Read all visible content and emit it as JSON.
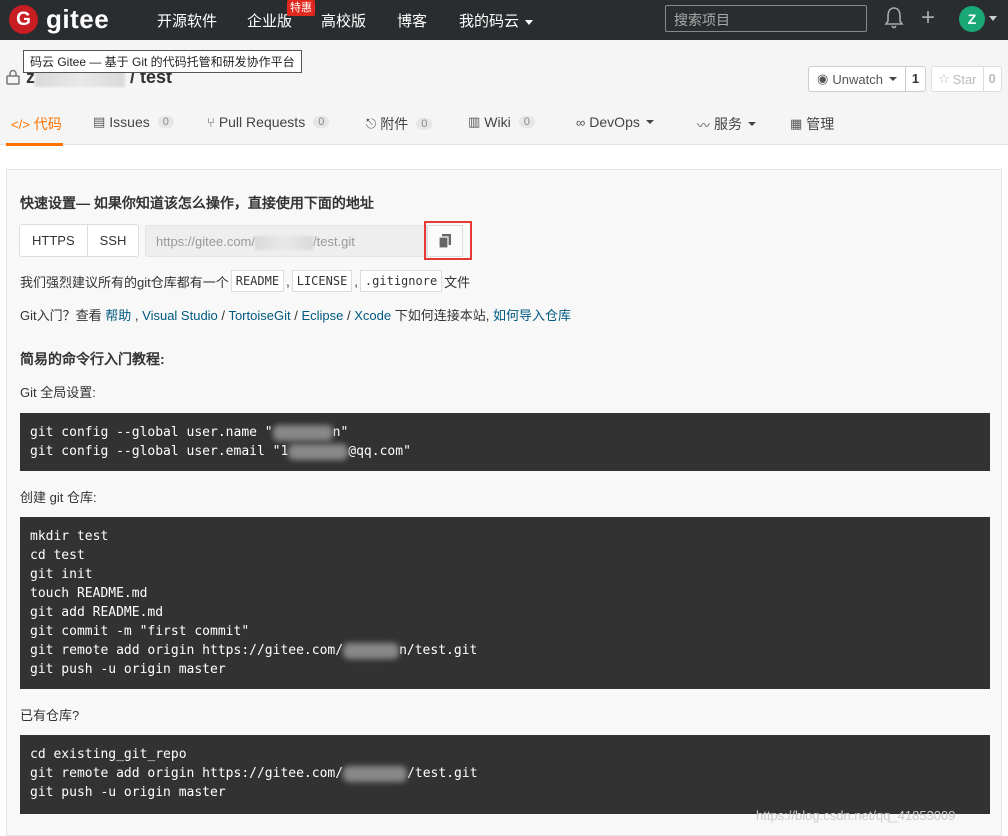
{
  "nav": {
    "logo_letter": "G",
    "logo_text": "gitee",
    "links": [
      "开源软件",
      "企业版",
      "高校版",
      "博客",
      "我的码云"
    ],
    "hot_badge": "特惠",
    "search_placeholder": "搜索项目",
    "avatar_letter": "Z"
  },
  "repo": {
    "tooltip": "码云 Gitee — 基于 Git 的代码托管和研发协作平台",
    "owner_initial": "z",
    "name": "/ test",
    "watch_label": "Unwatch",
    "watch_count": "1",
    "star_label": "Star",
    "star_count": "0"
  },
  "tabs": [
    {
      "label": "代码",
      "icon": "code-icon"
    },
    {
      "label": "Issues",
      "count": "0",
      "icon": "issues-icon"
    },
    {
      "label": "Pull Requests",
      "count": "0",
      "icon": "pull-request-icon"
    },
    {
      "label": "附件",
      "count": "0",
      "icon": "attachment-icon"
    },
    {
      "label": "Wiki",
      "count": "0",
      "icon": "wiki-icon"
    },
    {
      "label": "DevOps",
      "icon": "devops-icon"
    },
    {
      "label": "服务",
      "icon": "pulse-icon"
    },
    {
      "label": "管理",
      "icon": "manage-icon"
    }
  ],
  "quick": {
    "title": "快速设置— 如果你知道该怎么操作，直接使用下面的地址",
    "https": "HTTPS",
    "ssh": "SSH",
    "url_prefix": "https://gitee.com/",
    "url_suffix": "/test.git",
    "recommend_prefix": "我们强烈建议所有的git仓库都有一个",
    "readme": "README",
    "license": "LICENSE",
    "gitignore": ".gitignore",
    "recommend_suffix": "文件",
    "comma": ",",
    "intro_prefix": "Git入门？查看",
    "help": "帮助",
    "vs": "Visual Studio",
    "tortoise": "TortoiseGit",
    "eclipse": "Eclipse",
    "xcode": "Xcode",
    "slash": "/",
    "intro_mid": "下如何连接本站,",
    "import": "如何导入仓库"
  },
  "tutorial": {
    "title": "简易的命令行入门教程:",
    "global_label": "Git 全局设置:",
    "global_line1_a": "git config --global user.name \"",
    "global_line1_b": "n\"",
    "global_line2_a": "git config --global user.email \"1",
    "global_line2_b": "@qq.com\"",
    "create_label": "创建 git 仓库:",
    "create_lines": [
      "mkdir test",
      "cd test",
      "git init",
      "touch README.md",
      "git add README.md",
      "git commit -m \"first commit\""
    ],
    "create_remote_a": "git remote add origin https://gitee.com/",
    "create_remote_b": "n/test.git",
    "create_push": "git push -u origin master",
    "existing_label": "已有仓库?",
    "existing_cd": "cd existing_git_repo",
    "existing_remote_a": "git remote add origin https://gitee.com/",
    "existing_remote_b": "/test.git",
    "existing_push": "git push -u origin master"
  },
  "watermark": "https://blog.csdn.net/qq_41853009"
}
